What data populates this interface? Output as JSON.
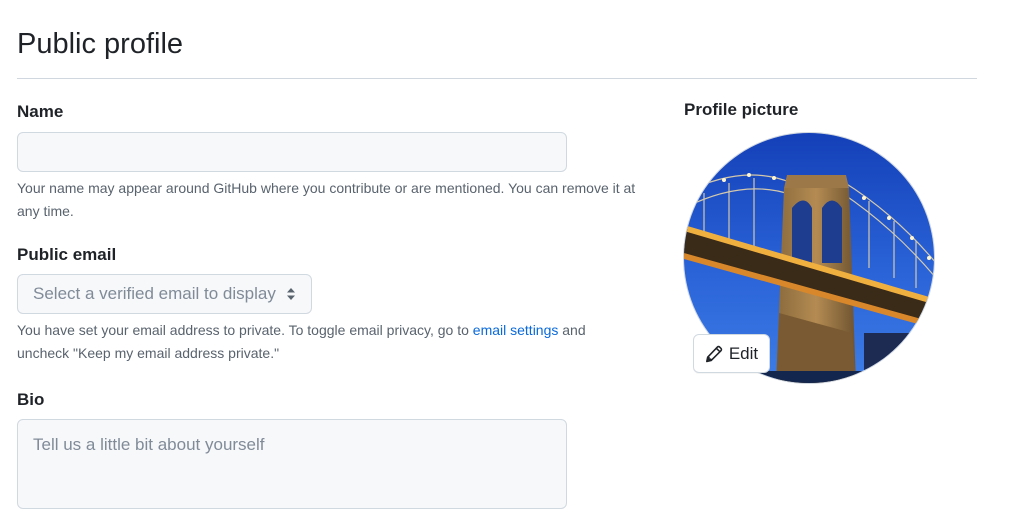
{
  "page": {
    "title": "Public profile"
  },
  "name": {
    "label": "Name",
    "value": "",
    "placeholder": "",
    "note": "Your name may appear around GitHub where you contribute or are mentioned. You can remove it at any time."
  },
  "public_email": {
    "label": "Public email",
    "selected": "Select a verified email to display",
    "note_before": "You have set your email address to private. To toggle email privacy, go to",
    "note_link": "email settings",
    "note_after": "and uncheck \"Keep my email address private.\""
  },
  "bio": {
    "label": "Bio",
    "placeholder": "Tell us a little bit about yourself"
  },
  "profile_picture": {
    "label": "Profile picture",
    "edit_label": "Edit",
    "image": "brooklyn-bridge-photo"
  },
  "colors": {
    "link": "#0969da",
    "input_bg": "#f6f8fa",
    "border": "#d1d9e0"
  }
}
